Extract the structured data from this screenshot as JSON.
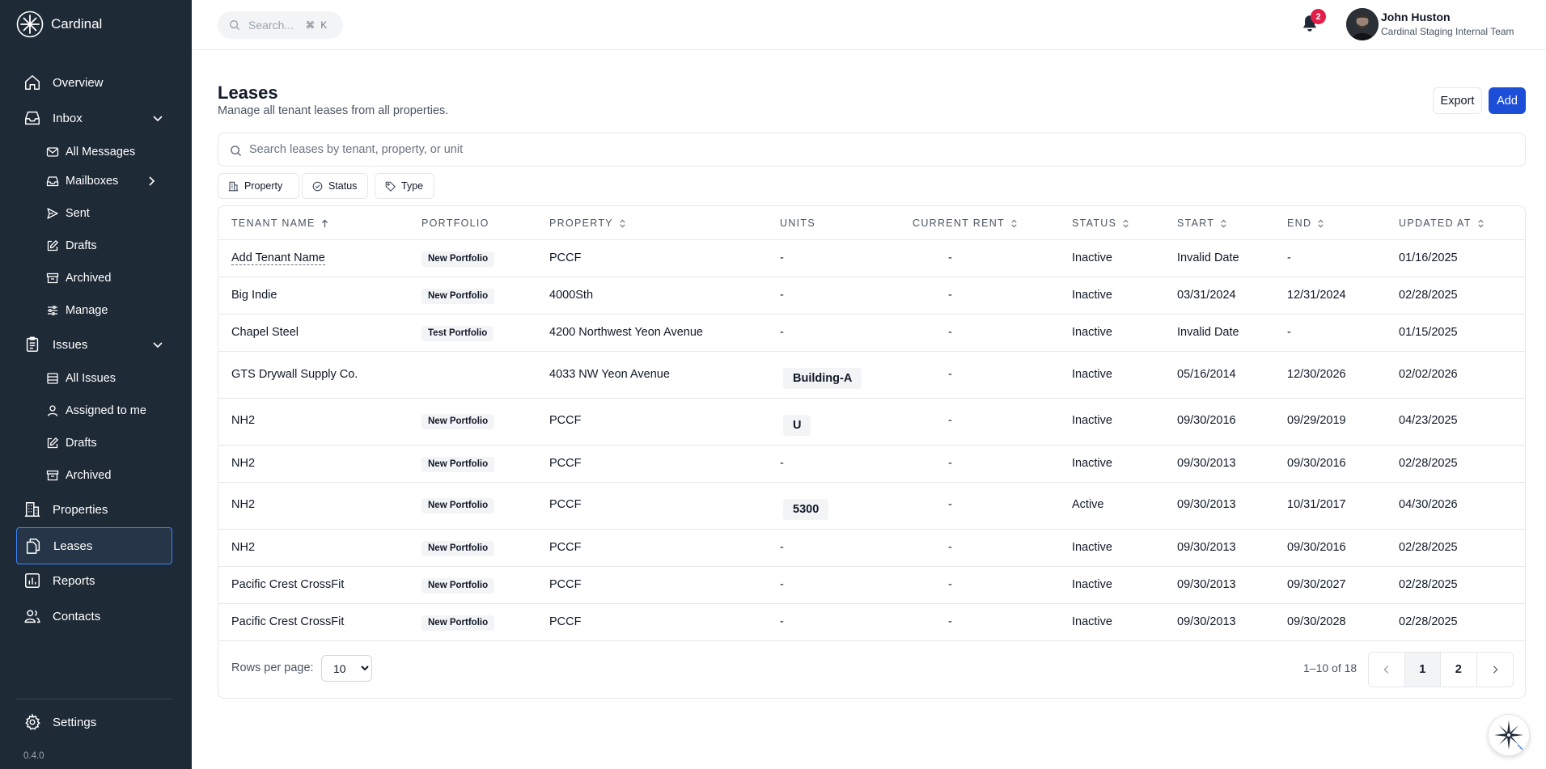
{
  "brand": {
    "name": "Cardinal"
  },
  "sidebar": {
    "nav": [
      {
        "label": "Overview",
        "icon": "home-icon"
      },
      {
        "label": "Inbox",
        "icon": "inbox-icon",
        "expanded": true
      },
      {
        "label": "All Messages",
        "icon": "mail-icon"
      },
      {
        "label": "Mailboxes",
        "icon": "mailboxes-icon"
      },
      {
        "label": "Sent",
        "icon": "send-icon"
      },
      {
        "label": "Drafts",
        "icon": "edit-icon"
      },
      {
        "label": "Archived",
        "icon": "archive-icon"
      },
      {
        "label": "Manage",
        "icon": "sliders-icon"
      },
      {
        "label": "Issues",
        "icon": "clipboard-icon",
        "expanded": true
      },
      {
        "label": "All Issues",
        "icon": "list-icon"
      },
      {
        "label": "Assigned to me",
        "icon": "user-icon"
      },
      {
        "label": "Drafts",
        "icon": "edit-icon"
      },
      {
        "label": "Archived",
        "icon": "archive-icon"
      },
      {
        "label": "Properties",
        "icon": "building-icon"
      },
      {
        "label": "Leases",
        "icon": "documents-icon",
        "active": true
      },
      {
        "label": "Reports",
        "icon": "chart-icon"
      },
      {
        "label": "Contacts",
        "icon": "users-icon"
      }
    ],
    "settings_label": "Settings",
    "version": "0.4.0"
  },
  "topbar": {
    "search_placeholder": "Search...",
    "search_shortcut": "⌘ K",
    "notification_count": "2",
    "user_name": "John Huston",
    "user_team": "Cardinal Staging Internal Team"
  },
  "page": {
    "title": "Leases",
    "subtitle": "Manage all tenant leases from all properties.",
    "export_label": "Export",
    "add_label": "Add",
    "search_placeholder": "Search leases by tenant, property, or unit",
    "filters": [
      {
        "label": "Property",
        "icon": "building-icon"
      },
      {
        "label": "Status",
        "icon": "check-circle-icon"
      },
      {
        "label": "Type",
        "icon": "tag-icon"
      }
    ]
  },
  "table": {
    "columns": [
      "TENANT NAME",
      "PORTFOLIO",
      "PROPERTY",
      "UNITS",
      "CURRENT RENT",
      "STATUS",
      "START",
      "END",
      "UPDATED AT"
    ],
    "rows": [
      {
        "tenant": "Add Tenant Name",
        "portfolio": "New Portfolio",
        "property": "PCCF",
        "unit": "-",
        "rent": "-",
        "status": "Inactive",
        "start": "Invalid Date",
        "end": "-",
        "updated": "01/16/2025"
      },
      {
        "tenant": "Big Indie",
        "portfolio": "New Portfolio",
        "property": "4000Sth",
        "unit": "-",
        "rent": "-",
        "status": "Inactive",
        "start": "03/31/2024",
        "end": "12/31/2024",
        "updated": "02/28/2025"
      },
      {
        "tenant": "Chapel Steel",
        "portfolio": "Test Portfolio",
        "property": "4200 Northwest Yeon Avenue",
        "unit": "-",
        "rent": "-",
        "status": "Inactive",
        "start": "Invalid Date",
        "end": "-",
        "updated": "01/15/2025"
      },
      {
        "tenant": "GTS Drywall Supply Co.",
        "portfolio": "",
        "property": "4033 NW Yeon Avenue",
        "unit": "Building-A",
        "rent": "-",
        "status": "Inactive",
        "start": "05/16/2014",
        "end": "12/30/2026",
        "updated": "02/02/2026"
      },
      {
        "tenant": "NH2",
        "portfolio": "New Portfolio",
        "property": "PCCF",
        "unit": "U",
        "rent": "-",
        "status": "Inactive",
        "start": "09/30/2016",
        "end": "09/29/2019",
        "updated": "04/23/2025"
      },
      {
        "tenant": "NH2",
        "portfolio": "New Portfolio",
        "property": "PCCF",
        "unit": "-",
        "rent": "-",
        "status": "Inactive",
        "start": "09/30/2013",
        "end": "09/30/2016",
        "updated": "02/28/2025"
      },
      {
        "tenant": "NH2",
        "portfolio": "New Portfolio",
        "property": "PCCF",
        "unit": "5300",
        "rent": "-",
        "status": "Active",
        "start": "09/30/2013",
        "end": "10/31/2017",
        "updated": "04/30/2026"
      },
      {
        "tenant": "NH2",
        "portfolio": "New Portfolio",
        "property": "PCCF",
        "unit": "-",
        "rent": "-",
        "status": "Inactive",
        "start": "09/30/2013",
        "end": "09/30/2016",
        "updated": "02/28/2025"
      },
      {
        "tenant": "Pacific Crest CrossFit",
        "portfolio": "New Portfolio",
        "property": "PCCF",
        "unit": "-",
        "rent": "-",
        "status": "Inactive",
        "start": "09/30/2013",
        "end": "09/30/2027",
        "updated": "02/28/2025"
      },
      {
        "tenant": "Pacific Crest CrossFit",
        "portfolio": "New Portfolio",
        "property": "PCCF",
        "unit": "-",
        "rent": "-",
        "status": "Inactive",
        "start": "09/30/2013",
        "end": "09/30/2028",
        "updated": "02/28/2025"
      }
    ],
    "rows_per_page_label": "Rows per page:",
    "rows_per_page_value": "10",
    "range_text": "1–10 of 18",
    "pages": [
      "1",
      "2"
    ],
    "current_page": "1"
  },
  "colors": {
    "sidebar_bg": "#1f2a37",
    "accent": "#1d4ed8",
    "badge": "#e11d48"
  }
}
